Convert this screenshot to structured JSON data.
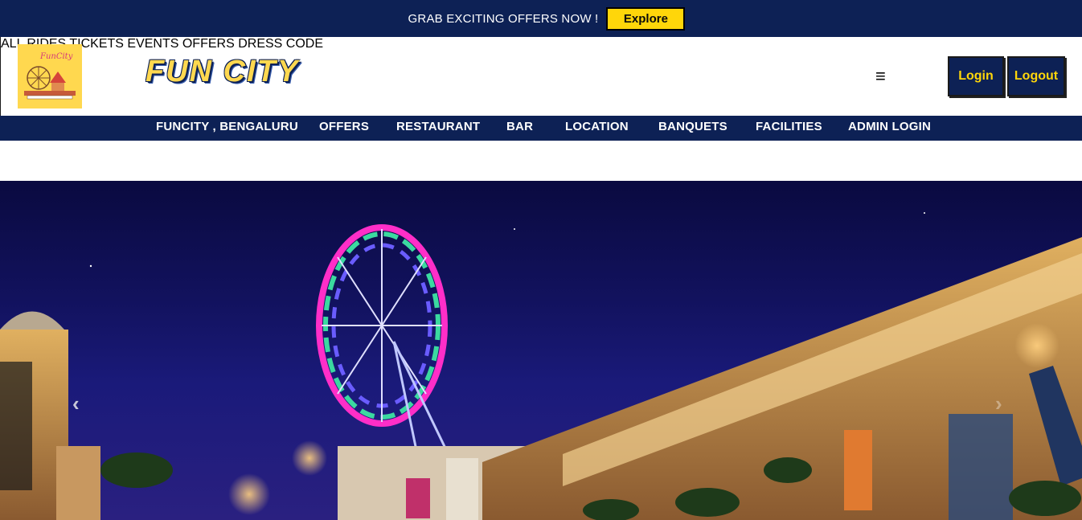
{
  "promo": {
    "text": "GRAB EXCITING OFFERS NOW !",
    "button": "Explore"
  },
  "header": {
    "logo_text": "FunCity",
    "brand": "FUN CITY",
    "nav": [
      "ALL RIDES",
      "TICKETS",
      "EVENTS",
      "OFFERS",
      "DRESS CODE"
    ],
    "menu_icon": "≡",
    "login": "Login",
    "logout": "Logout"
  },
  "subnav": [
    "FUNCITY , BENGALURU",
    "OFFERS",
    "RESTAURANT",
    "BAR",
    "LOCATION",
    "BANQUETS",
    "FACILITIES",
    "ADMIN LOGIN"
  ],
  "hero": {
    "prev": "‹",
    "next": "›"
  },
  "colors": {
    "navy": "#0d2155",
    "yellow": "#ffd60a",
    "logo_bg": "#ffd84f"
  }
}
